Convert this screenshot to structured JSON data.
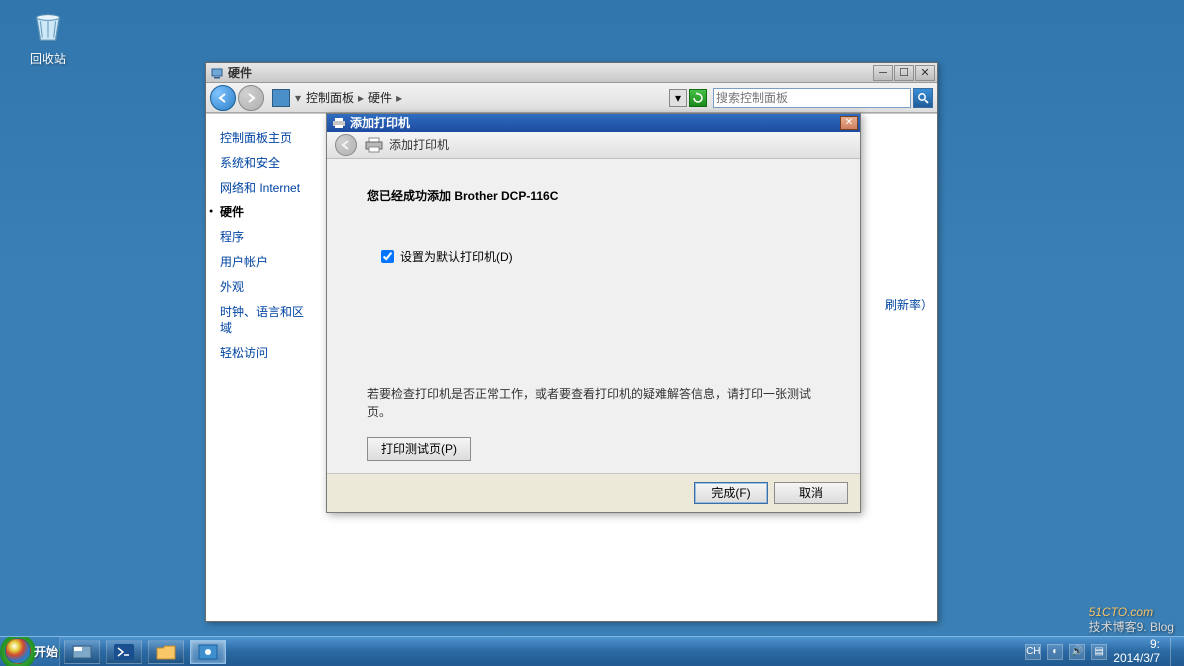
{
  "desktop": {
    "recycle_bin": "回收站"
  },
  "window": {
    "title": "硬件",
    "crumb1": "控制面板",
    "crumb2": "硬件",
    "search_placeholder": "搜索控制面板"
  },
  "sidebar": {
    "items": [
      "控制面板主页",
      "系统和安全",
      "网络和 Internet",
      "硬件",
      "程序",
      "用户帐户",
      "外观",
      "时钟、语言和区域",
      "轻松访问"
    ],
    "active_index": 3,
    "bg_link": "刷新率）"
  },
  "dialog": {
    "title": "添加打印机",
    "header": "添加打印机",
    "success_prefix": "您已经成功添加 ",
    "printer": "Brother DCP-116C",
    "checkbox": "设置为默认打印机(D)",
    "hint": "若要检查打印机是否正常工作，或者要查看打印机的疑难解答信息，请打印一张测试页。",
    "print_test": "打印测试页(P)",
    "finish": "完成(F)",
    "cancel": "取消"
  },
  "taskbar": {
    "start": "开始",
    "lang": "CH",
    "time": "9:",
    "date": "2014/3/7"
  },
  "watermark": {
    "main": "51CTO.com",
    "sub": "技术博客9. Blog"
  }
}
